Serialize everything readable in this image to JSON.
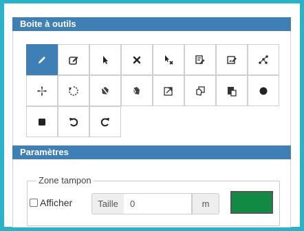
{
  "toolbox": {
    "title": "Boite à outils",
    "tools": [
      {
        "icon": "pencil-icon",
        "active": true
      },
      {
        "icon": "edit-square-icon",
        "active": false
      },
      {
        "icon": "select-arrow-icon",
        "active": false
      },
      {
        "icon": "delete-x-icon",
        "active": false
      },
      {
        "icon": "deselect-arrow-x-icon",
        "active": false
      },
      {
        "icon": "edit-attributes-icon",
        "active": false
      },
      {
        "icon": "edit-image-icon",
        "active": false
      },
      {
        "icon": "vertex-share-icon",
        "active": false
      },
      {
        "icon": "move-arrows-icon",
        "active": false
      },
      {
        "icon": "rotate-icon",
        "active": false
      },
      {
        "icon": "split-shape-icon",
        "active": false
      },
      {
        "icon": "merge-shape-icon",
        "active": false
      },
      {
        "icon": "resize-icon",
        "active": false
      },
      {
        "icon": "duplicate-icon",
        "active": false
      },
      {
        "icon": "paste-icon",
        "active": false
      },
      {
        "icon": "circle-filled-icon",
        "active": false
      },
      {
        "icon": "square-filled-icon",
        "active": false
      },
      {
        "icon": "undo-icon",
        "active": false
      },
      {
        "icon": "redo-icon",
        "active": false
      }
    ]
  },
  "params": {
    "title": "Paramètres",
    "buffer": {
      "legend": "Zone tampon",
      "show_label": "Afficher",
      "show_checked": false,
      "size_label": "Taille",
      "size_value": "0",
      "unit": "m",
      "color": "#118a44"
    }
  }
}
